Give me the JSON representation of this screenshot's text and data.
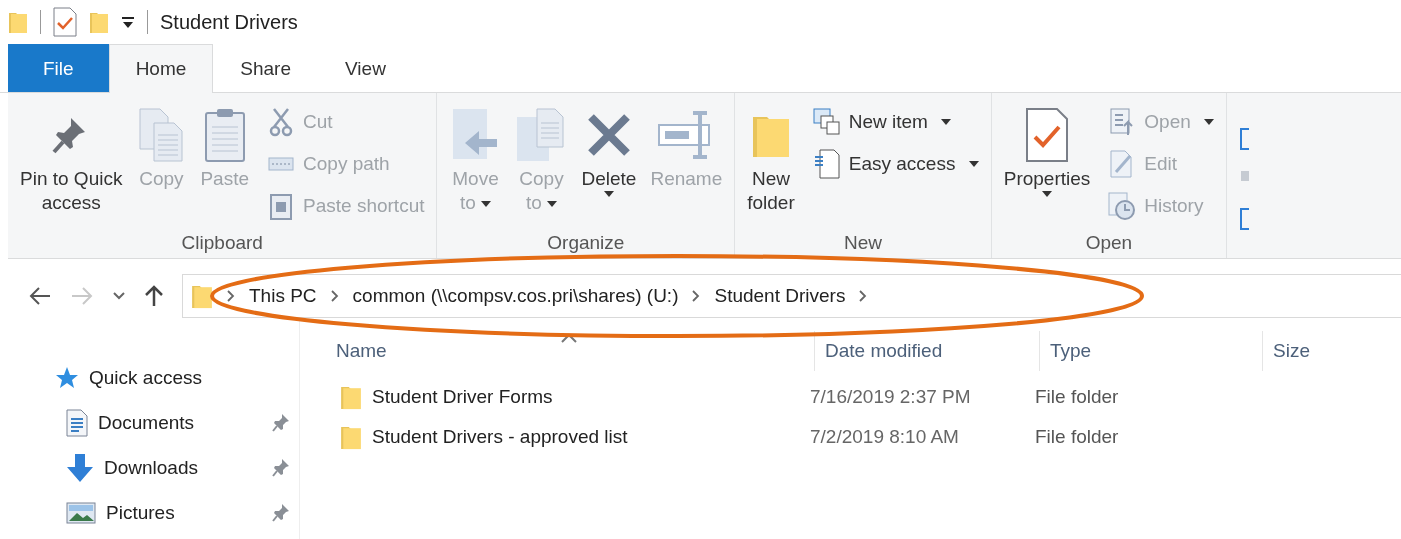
{
  "window": {
    "title": "Student Drivers"
  },
  "tabs": [
    {
      "label": "File",
      "selected": false,
      "kind": "file"
    },
    {
      "label": "Home",
      "selected": true,
      "kind": "tab"
    },
    {
      "label": "Share",
      "selected": false,
      "kind": "tab"
    },
    {
      "label": "View",
      "selected": false,
      "kind": "tab"
    }
  ],
  "ribbon": {
    "groups": [
      {
        "label": "Clipboard",
        "items": [
          {
            "kind": "large",
            "label": "Pin to Quick\naccess",
            "disabled": false,
            "dropdown": false
          },
          {
            "kind": "large",
            "label": "Copy",
            "disabled": true,
            "dropdown": false
          },
          {
            "kind": "large",
            "label": "Paste",
            "disabled": true,
            "dropdown": false
          },
          {
            "kind": "stack",
            "items": [
              {
                "label": "Cut",
                "disabled": true,
                "dropdown": false
              },
              {
                "label": "Copy path",
                "disabled": true,
                "dropdown": false
              },
              {
                "label": "Paste shortcut",
                "disabled": true,
                "dropdown": false
              }
            ]
          }
        ]
      },
      {
        "label": "Organize",
        "items": [
          {
            "kind": "large",
            "label": "Move\nto",
            "disabled": true,
            "dropdown": true
          },
          {
            "kind": "large",
            "label": "Copy\nto",
            "disabled": true,
            "dropdown": true
          },
          {
            "kind": "large",
            "label": "Delete",
            "disabled": false,
            "dropdown": true
          },
          {
            "kind": "large",
            "label": "Rename",
            "disabled": true,
            "dropdown": false
          }
        ]
      },
      {
        "label": "New",
        "items": [
          {
            "kind": "large",
            "label": "New\nfolder",
            "disabled": false,
            "dropdown": false
          },
          {
            "kind": "stack",
            "items": [
              {
                "label": "New item",
                "disabled": false,
                "dropdown": true
              },
              {
                "label": "Easy access",
                "disabled": false,
                "dropdown": true
              }
            ]
          }
        ]
      },
      {
        "label": "Open",
        "items": [
          {
            "kind": "large",
            "label": "Properties",
            "disabled": false,
            "dropdown": true
          },
          {
            "kind": "stack",
            "items": [
              {
                "label": "Open",
                "disabled": true,
                "dropdown": true
              },
              {
                "label": "Edit",
                "disabled": true,
                "dropdown": false
              },
              {
                "label": "History",
                "disabled": true,
                "dropdown": false
              }
            ]
          }
        ]
      }
    ]
  },
  "address": {
    "crumbs": [
      "This PC",
      "common (\\\\compsv.cos.pri\\shares) (U:)",
      "Student Drivers"
    ]
  },
  "navigation": {
    "items": [
      {
        "label": "Quick access",
        "kind": "quick",
        "pinned": false
      },
      {
        "label": "Documents",
        "kind": "documents",
        "pinned": true
      },
      {
        "label": "Downloads",
        "kind": "downloads",
        "pinned": true
      },
      {
        "label": "Pictures",
        "kind": "pictures",
        "pinned": true
      }
    ]
  },
  "files": {
    "columns": [
      "Name",
      "Date modified",
      "Type",
      "Size"
    ],
    "rows": [
      {
        "name": "Student Driver Forms",
        "date_modified": "7/16/2019 2:37 PM",
        "type": "File folder"
      },
      {
        "name": "Student Drivers - approved list",
        "date_modified": "7/2/2019 8:10 AM",
        "type": "File folder"
      }
    ]
  },
  "annotation": {
    "kind": "ellipse"
  }
}
